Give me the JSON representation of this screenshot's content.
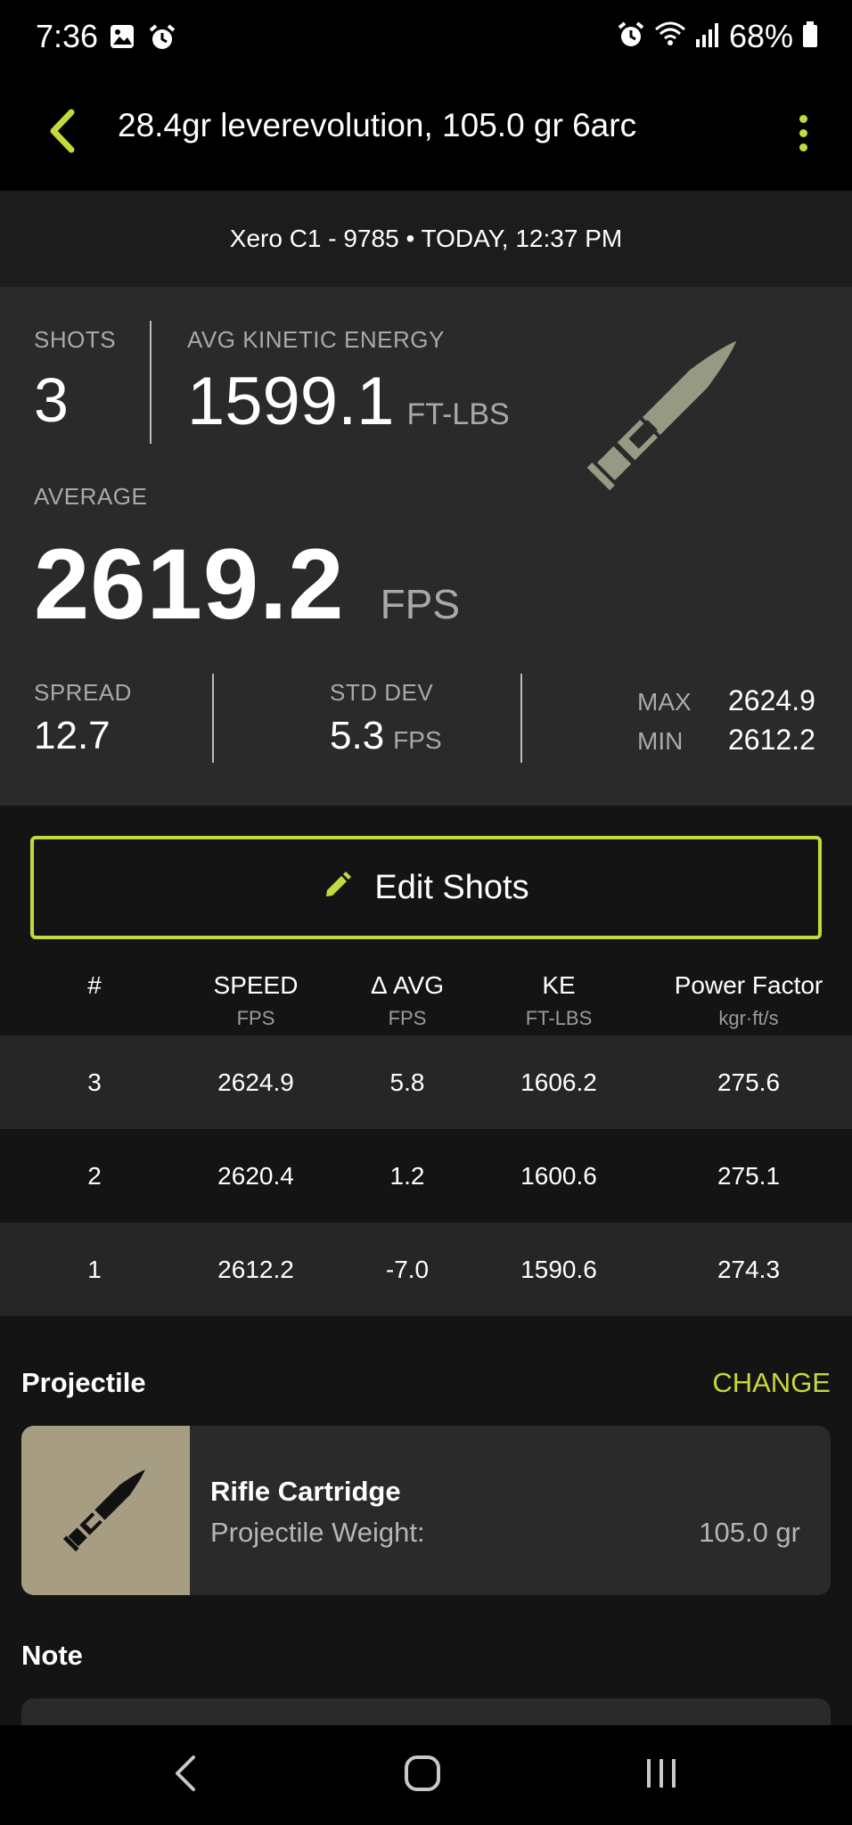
{
  "status_bar": {
    "time": "7:36",
    "battery": "68%"
  },
  "header": {
    "title": "28.4gr leverevolution, 105.0 gr 6arc"
  },
  "device": {
    "line": "Xero C1 - 9785 • TODAY, 12:37 PM"
  },
  "summary": {
    "shots_label": "SHOTS",
    "shots_value": "3",
    "ke_label": "AVG KINETIC ENERGY",
    "ke_value": "1599.1",
    "ke_unit": "FT-LBS",
    "average_label": "AVERAGE",
    "average_value": "2619.2",
    "average_unit": "FPS",
    "spread_label": "SPREAD",
    "spread_value": "12.7",
    "stddev_label": "STD DEV",
    "stddev_value": "5.3",
    "stddev_unit": "FPS",
    "max_label": "MAX",
    "max_value": "2624.9",
    "min_label": "MIN",
    "min_value": "2612.2"
  },
  "edit_button": {
    "label": "Edit Shots"
  },
  "table": {
    "columns": [
      {
        "title": "#",
        "unit": ""
      },
      {
        "title": "SPEED",
        "unit": "FPS"
      },
      {
        "title": "Δ AVG",
        "unit": "FPS"
      },
      {
        "title": "KE",
        "unit": "FT-LBS"
      },
      {
        "title": "Power Factor",
        "unit": "kgr·ft/s"
      }
    ],
    "rows": [
      [
        "3",
        "2624.9",
        "5.8",
        "1606.2",
        "275.6"
      ],
      [
        "2",
        "2620.4",
        "1.2",
        "1600.6",
        "275.1"
      ],
      [
        "1",
        "2612.2",
        "-7.0",
        "1590.6",
        "274.3"
      ]
    ]
  },
  "projectile": {
    "heading": "Projectile",
    "change_label": "CHANGE",
    "name": "Rifle Cartridge",
    "weight_label": "Projectile Weight:",
    "weight_value": "105.0 gr"
  },
  "note": {
    "heading": "Note"
  },
  "colors": {
    "accent": "#c6d93c",
    "bullet": "#979a82",
    "thumb_bg": "#a69d82"
  },
  "icons": [
    "image-icon",
    "alarm-icon",
    "wifi-icon",
    "signal-icon",
    "battery-icon",
    "back-arrow-icon",
    "more-vert-icon",
    "bullet-icon",
    "pencil-icon",
    "nav-back-icon",
    "nav-home-icon",
    "nav-recents-icon"
  ]
}
